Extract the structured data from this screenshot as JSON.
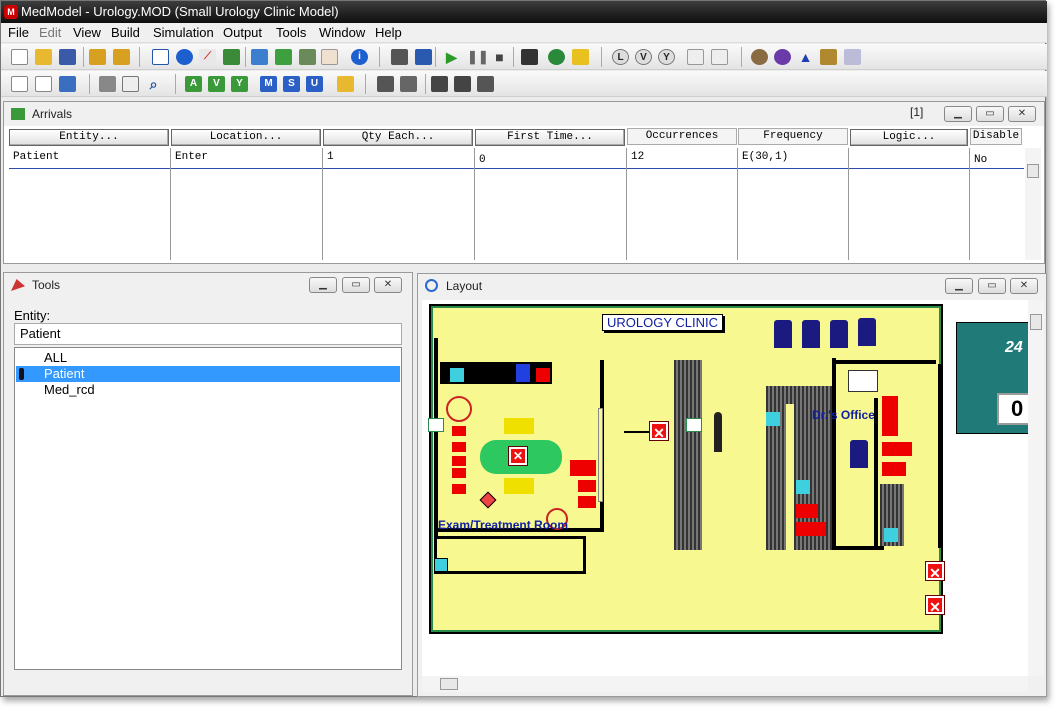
{
  "app": {
    "title": "MedModel - Urology.MOD (Small Urology Clinic Model)",
    "icon_letter": "M"
  },
  "menu": [
    "File",
    "Edit",
    "View",
    "Build",
    "Simulation",
    "Output",
    "Tools",
    "Window",
    "Help"
  ],
  "toolbar_row2_letters": [
    "A",
    "V",
    "Y",
    "M",
    "S",
    "U"
  ],
  "arrivals": {
    "title": "Arrivals",
    "page_indicator": "[1]",
    "columns": [
      "Entity...",
      "Location...",
      "Qty Each...",
      "First Time...",
      "Occurrences",
      "Frequency",
      "Logic...",
      "Disable"
    ],
    "rows": [
      {
        "entity": "Patient",
        "location": "Enter",
        "qty": "1",
        "first_time": "0",
        "occurrences": "12",
        "frequency": "E(30,1)",
        "logic": "",
        "disable": "No"
      }
    ]
  },
  "tools": {
    "title": "Tools",
    "entity_label": "Entity:",
    "entity_value": "Patient",
    "list": [
      "ALL",
      "Patient",
      "Med_rcd"
    ],
    "selected_index": 1
  },
  "layout": {
    "title": "Layout",
    "clinic_label": "UROLOGY CLINIC",
    "room_label": "Exam/Treatment Room",
    "office_label": "Dr.'s Office",
    "clock_hours": "24",
    "clock_value": "0"
  },
  "colors": {
    "floor": "#f8f890",
    "wall": "#000000",
    "selection": "#3399ff",
    "clock_bg": "#1f7a78"
  }
}
